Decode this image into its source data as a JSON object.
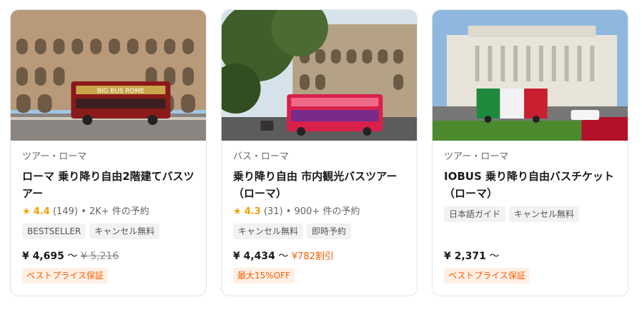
{
  "cards": [
    {
      "category": "ツアー・ローマ",
      "title": "ローマ 乗り降り自由2階建てバスツアー",
      "rating": "4.4",
      "reviews": "(149)",
      "bookings": "2K+ 件の予約",
      "tags": [
        "BESTSELLER",
        "キャンセル無料"
      ],
      "price": "¥ 4,695",
      "price_suffix": "〜",
      "original_price": "¥ 5,216",
      "promo": "ベストプライス保証",
      "bus_text": "BIG BUS ROME"
    },
    {
      "category": "バス・ローマ",
      "title": "乗り降り自由 市内観光バスツアー（ローマ）",
      "rating": "4.3",
      "reviews": "(31)",
      "bookings": "900+ 件の予約",
      "tags": [
        "キャンセル無料",
        "即時予約"
      ],
      "price": "¥ 4,434",
      "price_suffix": "〜",
      "discount": "¥782割引",
      "promo": "最大15%OFF"
    },
    {
      "category": "ツアー・ローマ",
      "title": "IOBUS 乗り降り自由バスチケット（ローマ）",
      "tags": [
        "日本語ガイド",
        "キャンセル無料"
      ],
      "price": "¥ 2,371",
      "price_suffix": "〜",
      "promo": "ベストプライス保証"
    }
  ],
  "separator": "•",
  "star_icon": "star-icon",
  "colors": {
    "accent": "#ff5b00",
    "star": "#f0a000",
    "promo_bg": "#fff0e6",
    "tag_bg": "#f2f2f2"
  }
}
